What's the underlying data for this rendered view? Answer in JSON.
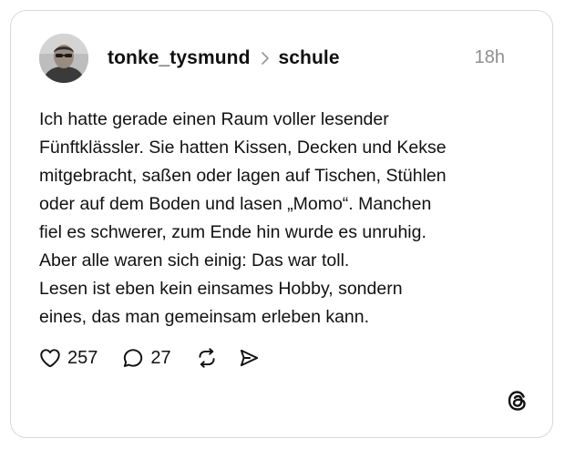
{
  "post": {
    "username": "tonke_tysmund",
    "community": "schule",
    "timestamp": "18h",
    "lines": [
      "Ich hatte gerade einen Raum voller lesender",
      "Fünftklässler. Sie hatten Kissen, Decken und Kekse",
      "mitgebracht, saßen oder lagen auf Tischen, Stühlen",
      "oder auf dem Boden und lasen „Momo“. Manchen",
      "fiel es schwerer, zum Ende hin wurde es unruhig.",
      "Aber alle waren sich einig: Das war toll.",
      "Lesen ist eben kein einsames Hobby, sondern",
      "eines, das man gemeinsam erleben kann."
    ]
  },
  "actions": {
    "likes": "257",
    "replies": "27"
  },
  "icons": {
    "separator": "chevron-right-icon",
    "like": "heart-icon",
    "reply": "comment-icon",
    "repost": "repost-icon",
    "share": "send-icon",
    "brand": "threads-logo-icon"
  },
  "colors": {
    "text": "#101010",
    "muted": "#8e8e8e",
    "border": "#d9d9d9"
  }
}
